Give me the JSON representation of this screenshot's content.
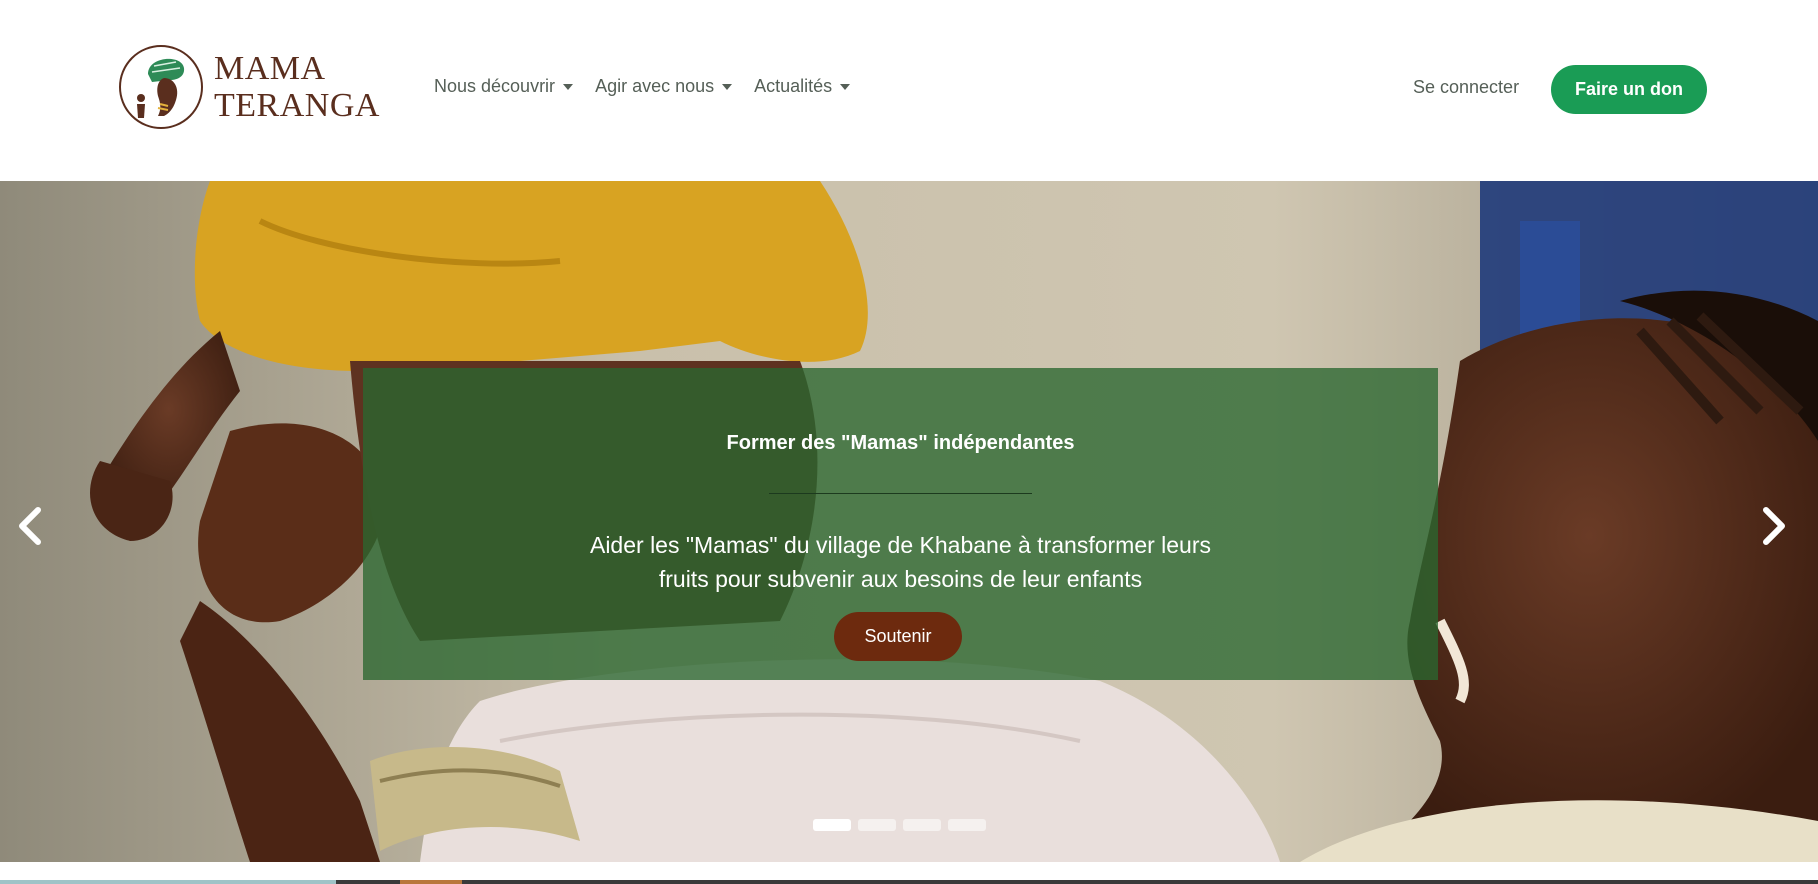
{
  "brand": {
    "line1": "MAMA",
    "line2": "TERANGA",
    "logo_icon": "african-woman-with-headwrap-logo",
    "color": "#5a2e1e"
  },
  "nav": {
    "items": [
      {
        "label": "Nous découvrir",
        "icon": "caret-down-icon"
      },
      {
        "label": "Agir avec nous",
        "icon": "caret-down-icon"
      },
      {
        "label": "Actualités",
        "icon": "caret-down-icon"
      }
    ]
  },
  "header_actions": {
    "login_label": "Se connecter",
    "donate_label": "Faire un don",
    "donate_color": "#1a9c55"
  },
  "carousel": {
    "slide": {
      "title": "Former des \"Mamas\" indépendantes",
      "text": "Aider les \"Mamas\" du village de Khabane à transformer leurs fruits pour subvenir aux besoins de leur enfants",
      "button_label": "Soutenir",
      "button_color": "#6d2a0e",
      "caption_color": "#2a6730"
    },
    "prev_icon": "chevron-left-icon",
    "next_icon": "chevron-right-icon",
    "indicator_count": 4,
    "active_index": 0
  }
}
